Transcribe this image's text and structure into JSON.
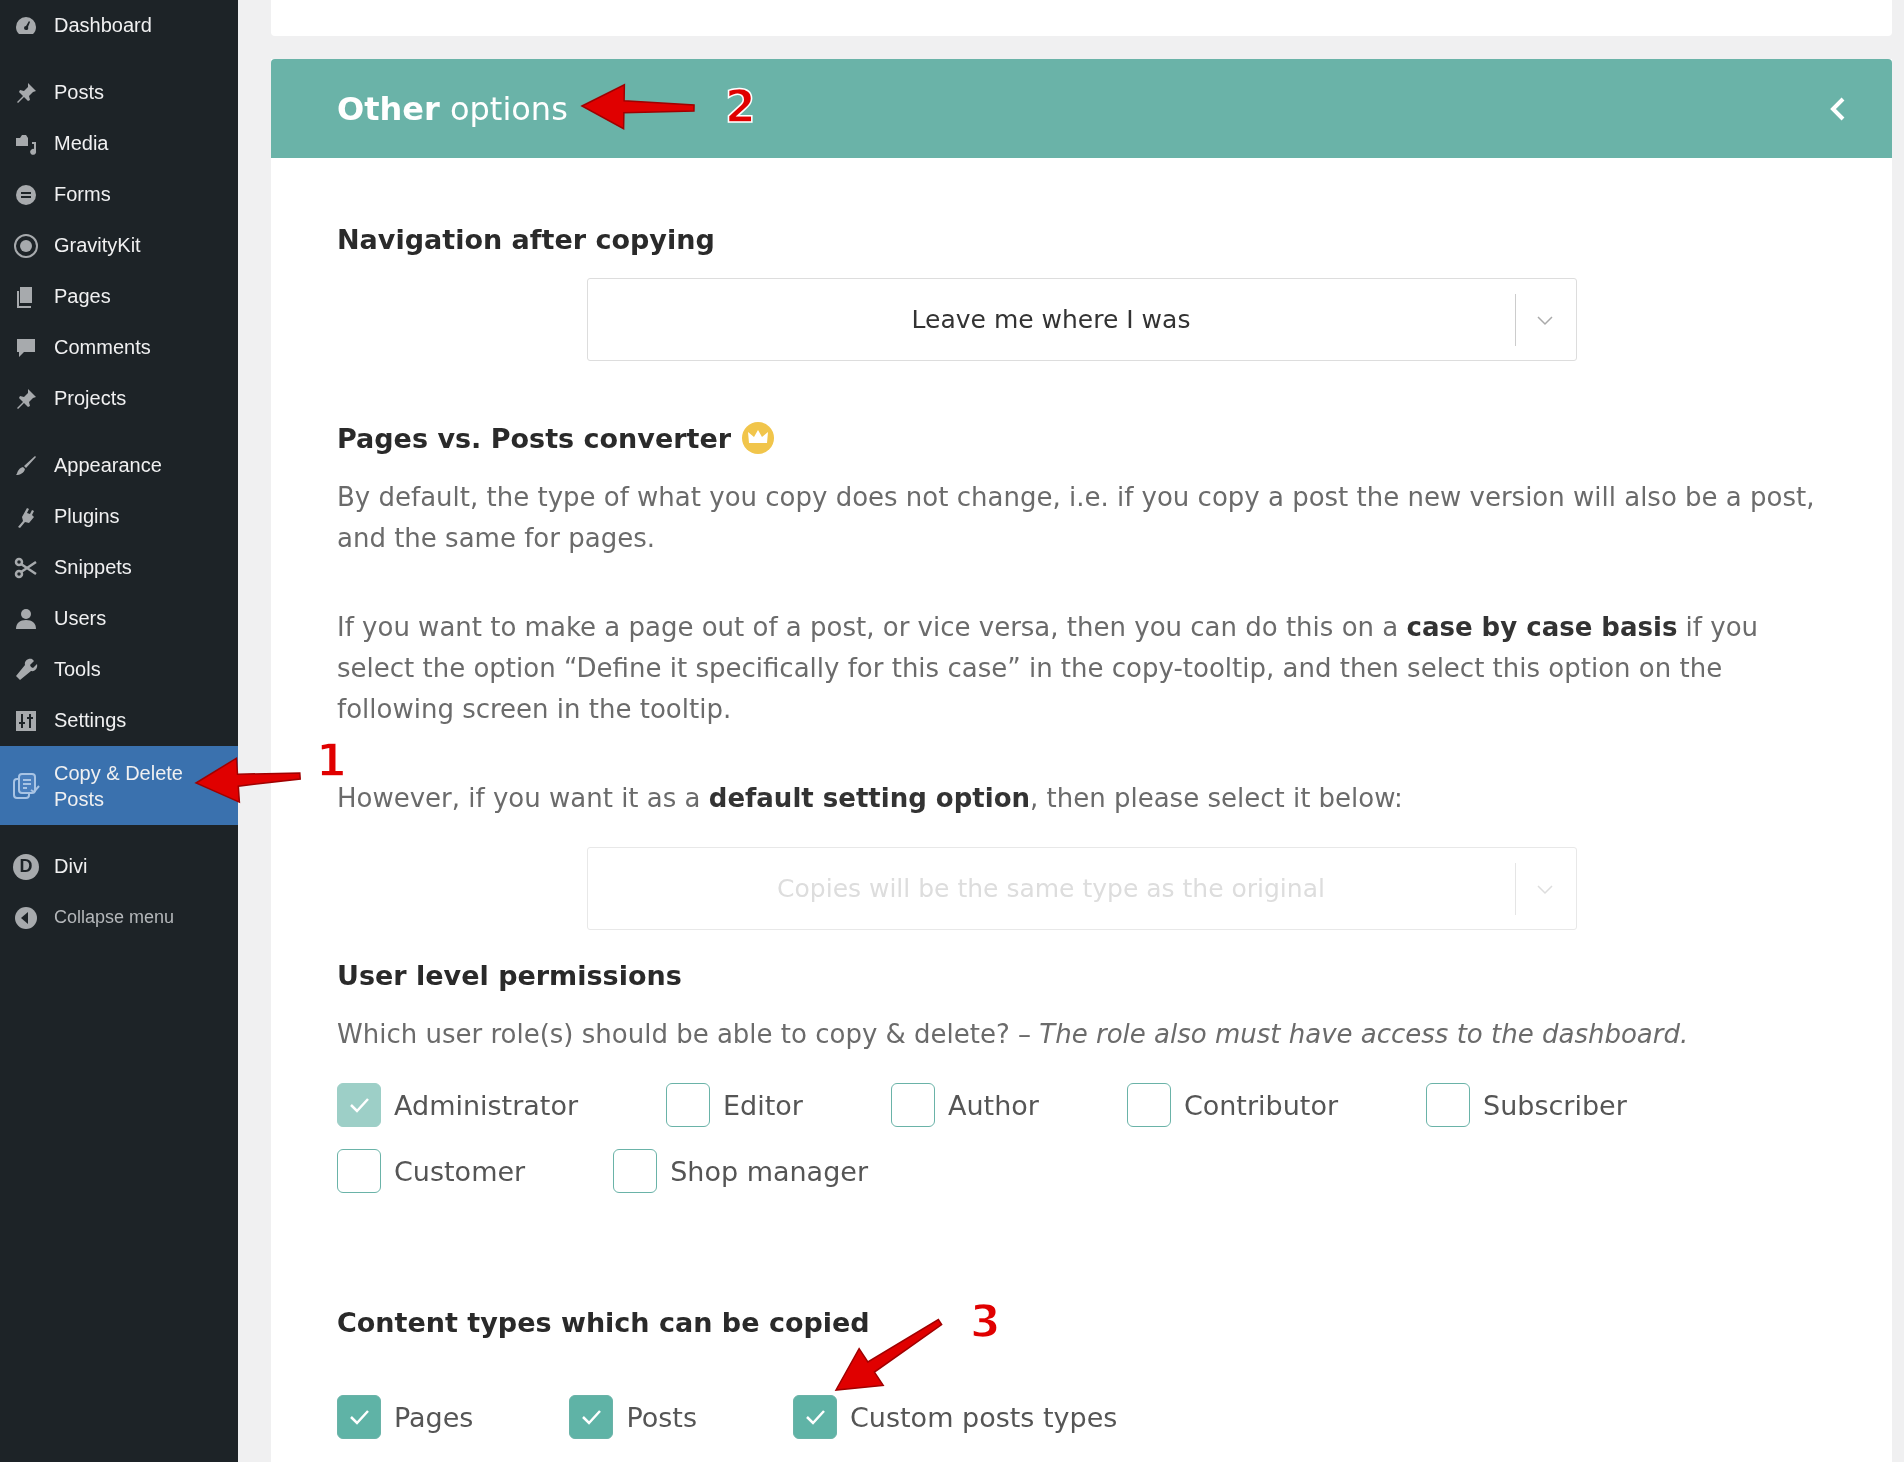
{
  "sidebar": {
    "items": [
      {
        "label": "Dashboard",
        "selected": false
      },
      {
        "label": "Posts",
        "selected": false
      },
      {
        "label": "Media",
        "selected": false
      },
      {
        "label": "Forms",
        "selected": false
      },
      {
        "label": "GravityKit",
        "selected": false
      },
      {
        "label": "Pages",
        "selected": false
      },
      {
        "label": "Comments",
        "selected": false
      },
      {
        "label": "Projects",
        "selected": false
      },
      {
        "label": "Appearance",
        "selected": false
      },
      {
        "label": "Plugins",
        "selected": false
      },
      {
        "label": "Snippets",
        "selected": false
      },
      {
        "label": "Users",
        "selected": false
      },
      {
        "label": "Tools",
        "selected": false
      },
      {
        "label": "Settings",
        "selected": false
      },
      {
        "label": "Copy & Delete Posts",
        "selected": true
      },
      {
        "label": "Divi",
        "selected": false,
        "icon_text": "D"
      },
      {
        "label": "Collapse menu",
        "selected": false
      }
    ]
  },
  "panel": {
    "title_bold": "Other",
    "title_rest": "options",
    "expanded": true
  },
  "sections": [
    {
      "heading": "Navigation after copying",
      "dropdown": {
        "value": "Leave me where I was",
        "disabled": false
      }
    },
    {
      "heading": "Pages vs. Posts converter",
      "premium": true,
      "paragraphs": [
        "By default, the type of what you copy does not change, i.e. if you copy a post the new version will also be a post, and the same for pages.",
        "If you want to make a page out of a post, or vice versa, then you can do this on a **case by case basis** if you select the option “Define it specifically for this case” in the copy-tooltip, and then select this option on the following screen in the tooltip.",
        "However, if you want it as a **default setting option**, then please select it below:"
      ],
      "dropdown": {
        "value": "Copies will be the same type as the original",
        "disabled": true
      }
    },
    {
      "heading": "User level permissions",
      "paragraphs": [
        "Which user role(s) should be able to copy & delete? – *The role also must have access to the dashboard.*"
      ],
      "checkboxes": [
        {
          "label": "Administrator",
          "checked": true,
          "disabled": true
        },
        {
          "label": "Editor",
          "checked": false,
          "disabled": false
        },
        {
          "label": "Author",
          "checked": false,
          "disabled": false
        },
        {
          "label": "Contributor",
          "checked": false,
          "disabled": false
        },
        {
          "label": "Subscriber",
          "checked": false,
          "disabled": false
        },
        {
          "label": "Customer",
          "checked": false,
          "disabled": false
        },
        {
          "label": "Shop manager",
          "checked": false,
          "disabled": false
        }
      ]
    },
    {
      "heading": "Content types which can be copied",
      "checkboxes": [
        {
          "label": "Pages",
          "checked": true,
          "disabled": false
        },
        {
          "label": "Posts",
          "checked": true,
          "disabled": false
        },
        {
          "label": "Custom posts types",
          "checked": true,
          "disabled": false
        }
      ]
    }
  ],
  "annotations": [
    {
      "label": "1"
    },
    {
      "label": "2"
    },
    {
      "label": "3"
    }
  ]
}
